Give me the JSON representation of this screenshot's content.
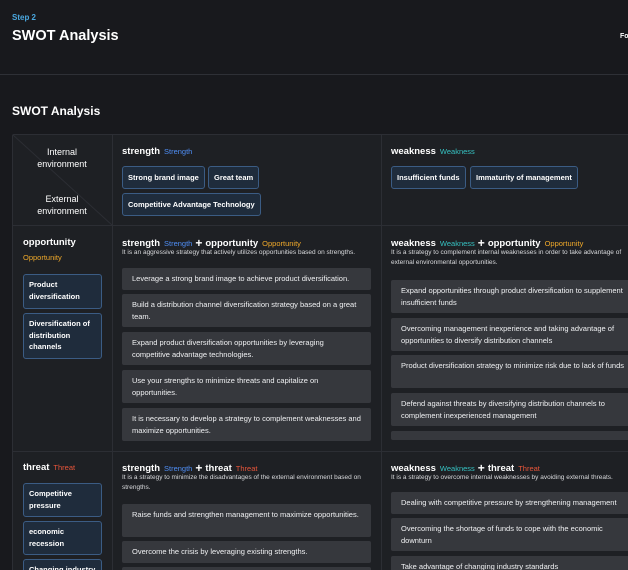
{
  "header": {
    "step": "Step 2",
    "title": "SWOT Analysis",
    "corner_link": "Fo"
  },
  "section_title": "SWOT Analysis",
  "env": {
    "internal": "Internal environment",
    "external": "External environment"
  },
  "cols": {
    "strength": {
      "label": "strength",
      "tag": "Strength",
      "chips": [
        "Strong brand image",
        "Great team",
        "Competitive Advantage Technology"
      ]
    },
    "weakness": {
      "label": "weakness",
      "tag": "Weakness",
      "chips": [
        "Insufficient funds",
        "Immaturity of management"
      ]
    }
  },
  "rows": {
    "opportunity": {
      "label": "opportunity",
      "tag": "Opportunity",
      "chips": [
        "Product diversification",
        "Diversification of distribution channels"
      ]
    },
    "threat": {
      "label": "threat",
      "tag": "Threat",
      "chips": [
        "Competitive pressure",
        "economic recession",
        "Changing industry"
      ]
    }
  },
  "plus": "+",
  "so": {
    "desc": "It is an aggressive strategy that actively utilizes opportunities based on strengths.",
    "items": [
      "Leverage a strong brand image to achieve product diversification.",
      "Build a distribution channel diversification strategy based on a great team.",
      "Expand product diversification opportunities by leveraging competitive advantage technologies.",
      "Use your strengths to minimize threats and capitalize on opportunities.",
      "It is necessary to develop a strategy to complement weaknesses and maximize opportunities."
    ]
  },
  "wo": {
    "desc": "It is a strategy to complement internal weaknesses in order to take advantage of external environmental opportunities.",
    "items": [
      "Expand opportunities through product diversification to supplement insufficient funds",
      "Overcoming management inexperience and taking advantage of opportunities to diversify distribution channels",
      "Product diversification strategy to minimize risk due to lack of funds",
      "Defend against threats by diversifying distribution channels to complement inexperienced management",
      ""
    ]
  },
  "st": {
    "desc": "It is a strategy to minimize the disadvantages of the external environment based on strengths.",
    "items": [
      "Raise funds and strengthen management to maximize opportunities.",
      "Overcome the crisis by leveraging existing strengths.",
      ""
    ]
  },
  "wt": {
    "desc": "It is a strategy to overcome internal weaknesses by avoiding external threats.",
    "items": [
      "Dealing with competitive pressure by strengthening management",
      "Overcoming the shortage of funds to cope with the economic downturn",
      "Take advantage of changing industry standards"
    ]
  }
}
